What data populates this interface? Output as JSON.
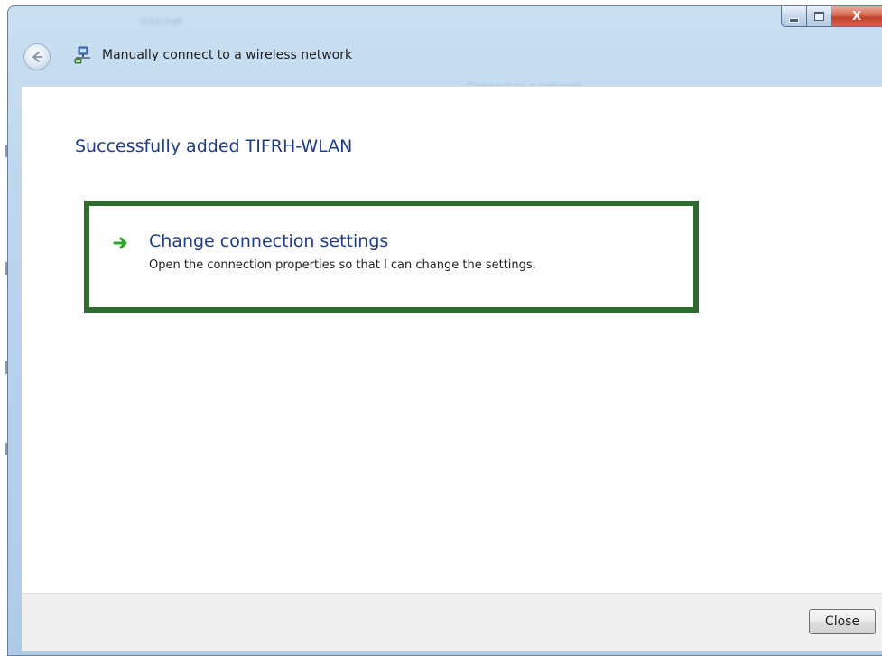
{
  "window": {
    "background_title_left": "Internet",
    "background_title_center": "Connect to a network",
    "caption_buttons": {
      "minimize_icon": "minimize-icon",
      "maximize_icon": "maximize-icon",
      "close_glyph": "X"
    }
  },
  "header": {
    "back_icon": "back-arrow-icon",
    "wizard_icon": "network-icon",
    "title": "Manually connect to a wireless network"
  },
  "main": {
    "heading": "Successfully added TIFRH-WLAN",
    "task": {
      "arrow_icon": "green-arrow-icon",
      "title": "Change connection settings",
      "description": "Open the connection properties so that I can change the settings."
    },
    "highlight_color": "#2f6b2f"
  },
  "footer": {
    "close_label": "Close"
  },
  "colors": {
    "link_blue": "#1f3c88",
    "titlebar": "#c9dff2",
    "footer_bg": "#f0f0f0"
  }
}
